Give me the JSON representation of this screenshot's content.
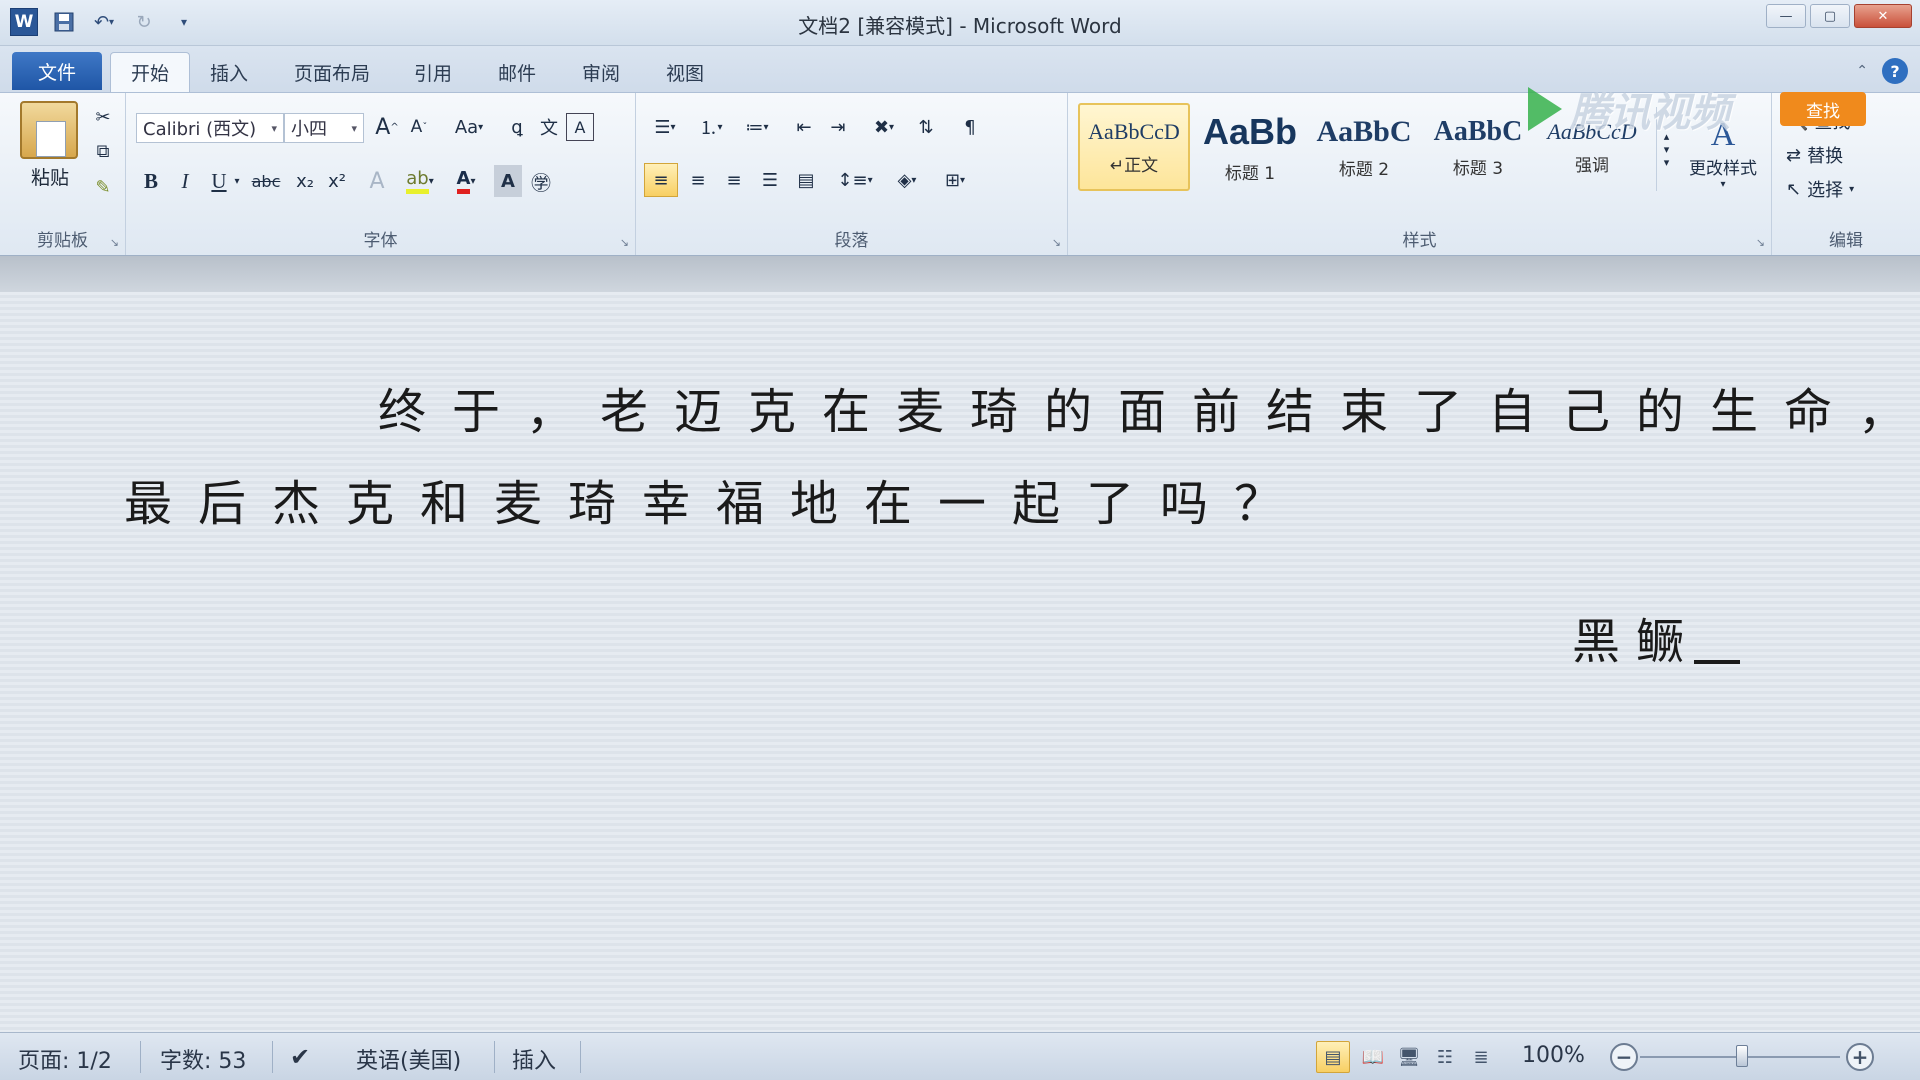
{
  "window": {
    "title": "文档2 [兼容模式] - Microsoft Word",
    "app_icon": "W",
    "buttons": {
      "minimize": "—",
      "maximize": "▢",
      "close": "✕"
    }
  },
  "qat": {
    "save_icon": "save-icon",
    "undo_icon": "undo-icon",
    "redo_icon": "redo-icon",
    "customize_icon": "customize-icon"
  },
  "tabs": [
    {
      "label": "文件"
    },
    {
      "label": "开始",
      "active": true
    },
    {
      "label": "插入"
    },
    {
      "label": "页面布局"
    },
    {
      "label": "引用"
    },
    {
      "label": "邮件"
    },
    {
      "label": "审阅"
    },
    {
      "label": "视图"
    }
  ],
  "ribbon": {
    "clipboard": {
      "label": "剪贴板",
      "paste": "粘贴"
    },
    "font": {
      "label": "字体",
      "font_name": "Calibri (西文)",
      "font_size": "小四",
      "bold": "B",
      "italic": "I",
      "underline": "U",
      "strikethrough": "abc",
      "subscript": "x₂",
      "superscript": "x²",
      "font_color": "A",
      "change_case": "Aa",
      "grow": "A",
      "shrink": "A"
    },
    "paragraph": {
      "label": "段落"
    },
    "styles": {
      "label": "样式",
      "items": [
        {
          "sample": "AaBbCcD",
          "name": "正文"
        },
        {
          "sample": "AaBb",
          "name": "标题 1"
        },
        {
          "sample": "AaBbC",
          "name": "标题 2"
        },
        {
          "sample": "AaBbC",
          "name": "标题 3"
        },
        {
          "sample": "AaBbCcD",
          "name": "强调"
        }
      ],
      "change_styles": "更改样式"
    },
    "editing": {
      "label": "编辑",
      "find": "查找",
      "replace": "替换",
      "select": "选择"
    }
  },
  "watermark": {
    "text": "腾讯视频"
  },
  "document": {
    "line1": "终于，老迈克在麦琦的面前结束了自己的生命，",
    "line2": "最后杰克和麦琦幸福地在一起了吗？",
    "signature": "黑鳜"
  },
  "status": {
    "page": "页面: 1/2",
    "words": "字数: 53",
    "language": "英语(美国)",
    "mode": "插入",
    "zoom": "100%",
    "zoom_value": 1.0
  },
  "colors": {
    "file_tab": "#2a5fae",
    "selected_style": "#fde59a",
    "accent": "#2b5797"
  }
}
